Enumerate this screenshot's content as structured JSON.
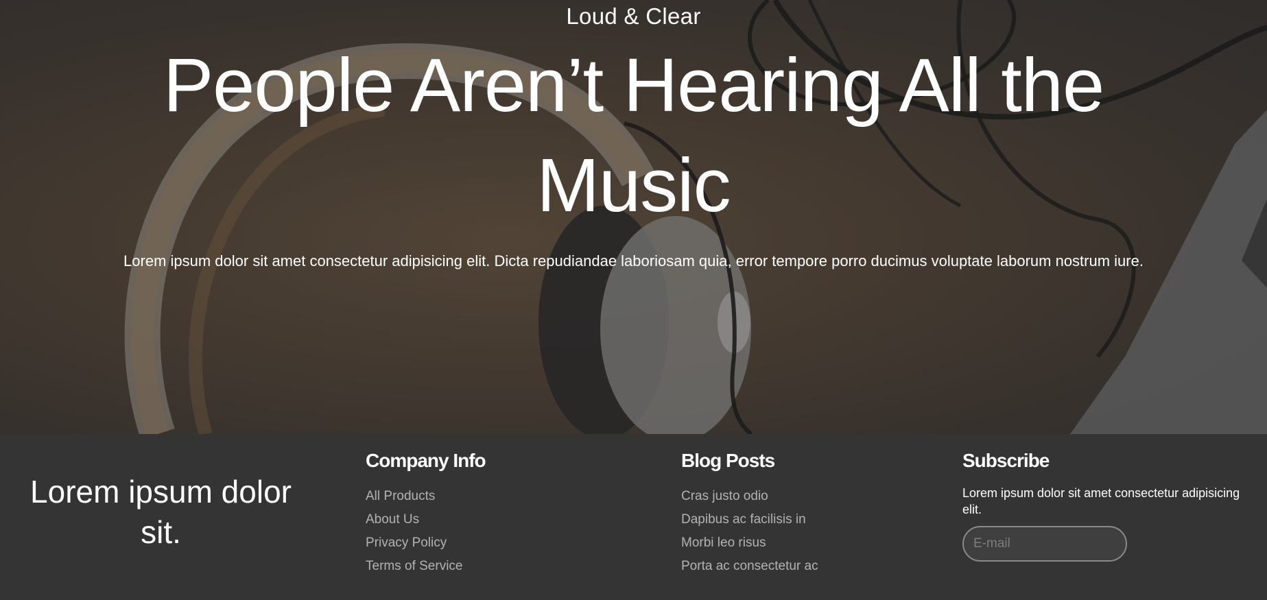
{
  "hero": {
    "tagline": "Loud & Clear",
    "headline": "People Aren’t Hearing All the Music",
    "lead": "Lorem ipsum dolor sit amet consectetur adipisicing elit. Dicta repudiandae laboriosam quia, error tempore porro ducimus voluptate laborum nostrum iure."
  },
  "footer": {
    "tagline": "Lorem ipsum dolor sit.",
    "company": {
      "heading": "Company Info",
      "links": [
        "All Products",
        "About Us",
        "Privacy Policy",
        "Terms of Service"
      ]
    },
    "blog": {
      "heading": "Blog Posts",
      "links": [
        "Cras justo odio",
        "Dapibus ac facilisis in",
        "Morbi leo risus",
        "Porta ac consectetur ac"
      ]
    },
    "subscribe": {
      "heading": "Subscribe",
      "text": "Lorem ipsum dolor sit amet consectetur adipisicing elit.",
      "email_placeholder": "E-mail"
    }
  },
  "colors": {
    "footer_bg": "#343434",
    "link": "#b3b3b3",
    "text": "#ffffff"
  }
}
